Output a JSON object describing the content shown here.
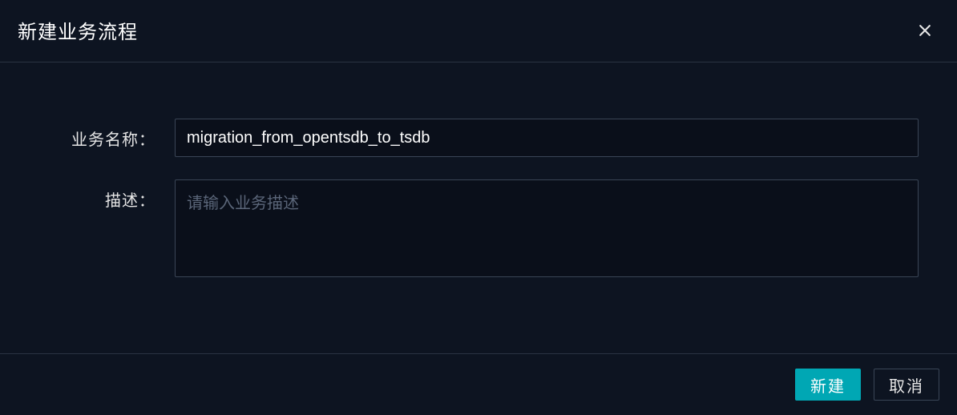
{
  "dialog": {
    "title": "新建业务流程",
    "form": {
      "name_label": "业务名称：",
      "name_value": "migration_from_opentsdb_to_tsdb",
      "desc_label": "描述：",
      "desc_value": "",
      "desc_placeholder": "请输入业务描述"
    },
    "buttons": {
      "create": "新建",
      "cancel": "取消"
    }
  }
}
